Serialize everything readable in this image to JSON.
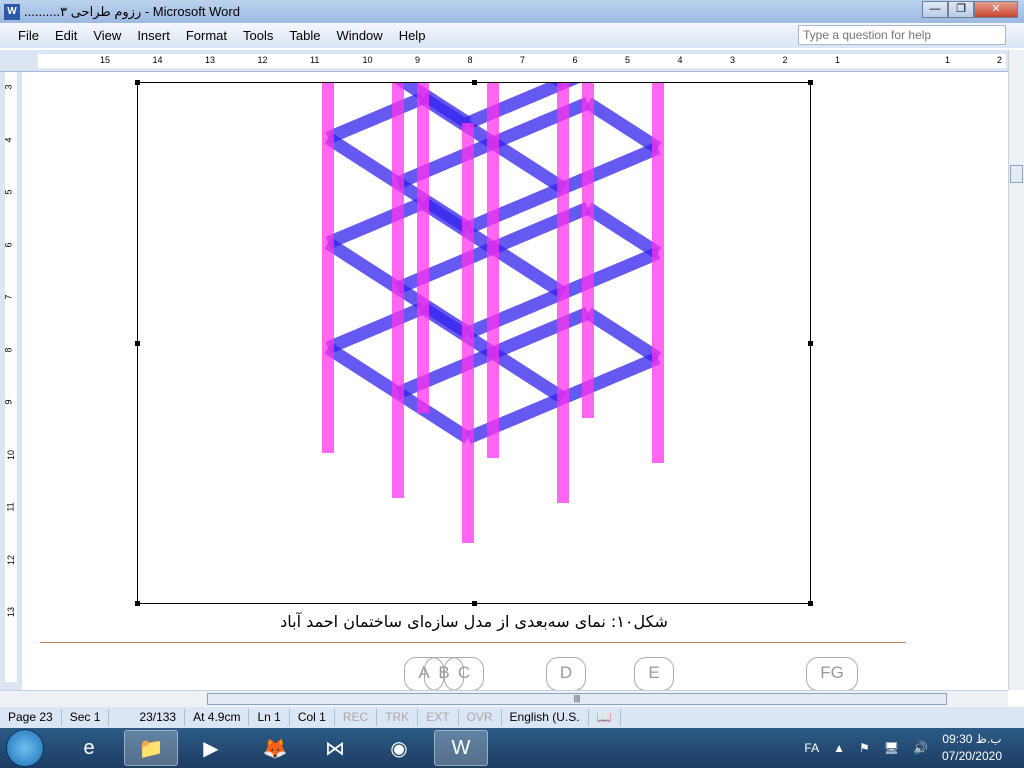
{
  "window": {
    "title": "..........رزوم طراحی ۳ - Microsoft Word",
    "minimize": "—",
    "maximize": "❐",
    "close": "✕"
  },
  "menu": [
    "File",
    "Edit",
    "View",
    "Insert",
    "Format",
    "Tools",
    "Table",
    "Window",
    "Help"
  ],
  "help": {
    "placeholder": "Type a question for help"
  },
  "ruler": {
    "h": [
      "15",
      "14",
      "13",
      "12",
      "11",
      "10",
      "9",
      "8",
      "7",
      "6",
      "5",
      "4",
      "3",
      "2",
      "1",
      "1",
      "2"
    ],
    "v": [
      "3",
      "4",
      "5",
      "6",
      "7",
      "8",
      "9",
      "10",
      "11",
      "12",
      "13"
    ]
  },
  "document": {
    "caption": "شکل۱۰: نمای سه‌بعدی از مدل سازه‌ای ساختمان احمد آباد",
    "grid_labels": [
      "A",
      "B",
      "C",
      "D",
      "E",
      "FG"
    ],
    "colors": {
      "columns": "#ff33ee",
      "beams": "#3322ee"
    }
  },
  "status": {
    "page": "Page 23",
    "sec": "Sec 1",
    "pages": "23/133",
    "at": "At 4.9cm",
    "ln": "Ln 1",
    "col": "Col 1",
    "rec": "REC",
    "trk": "TRK",
    "ext": "EXT",
    "ovr": "OVR",
    "lang": "English (U.S."
  },
  "taskbar": {
    "lang": "FA",
    "time": "09:30 ب.ظ",
    "date": "07/20/2020"
  }
}
